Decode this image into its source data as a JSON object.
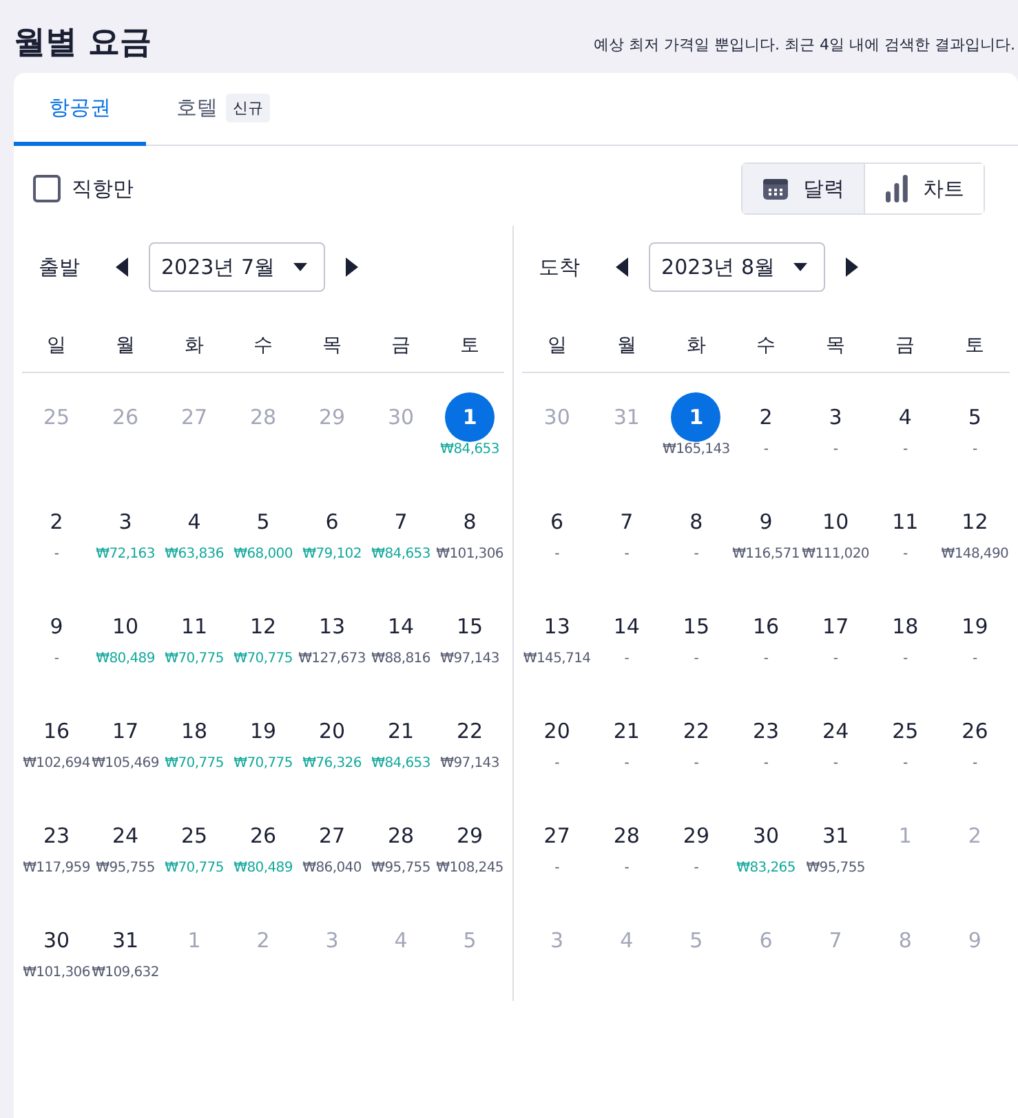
{
  "title": "월별 요금",
  "notice": "예상 최저 가격일 뿐입니다. 최근 4일 내에 검색한 결과입니다.",
  "tabs": [
    {
      "label": "항공권",
      "selected": true
    },
    {
      "label": "호텔",
      "badge": "신규",
      "selected": false
    }
  ],
  "direct_only": {
    "label": "직항만",
    "checked": false
  },
  "view_toggle": [
    {
      "label": "달력",
      "kind": "calendar",
      "selected": true
    },
    {
      "label": "차트",
      "kind": "chart",
      "selected": false
    }
  ],
  "calendars": [
    {
      "label": "출발",
      "month": "2023년 7월",
      "weekdays": [
        "일",
        "월",
        "화",
        "수",
        "목",
        "금",
        "토"
      ],
      "weeks": [
        [
          {
            "d": "25",
            "muted": true,
            "selected": false
          },
          {
            "d": "26",
            "muted": true,
            "selected": false
          },
          {
            "d": "27",
            "muted": true,
            "selected": false
          },
          {
            "d": "28",
            "muted": true,
            "selected": false
          },
          {
            "d": "29",
            "muted": true,
            "selected": false
          },
          {
            "d": "30",
            "muted": true,
            "selected": false
          },
          {
            "d": "1",
            "muted": false,
            "selected": true,
            "price": "₩84,653",
            "cheap": true
          }
        ],
        [
          {
            "d": "2",
            "muted": false,
            "selected": false,
            "price": "-",
            "cheap": false
          },
          {
            "d": "3",
            "muted": false,
            "selected": false,
            "price": "₩72,163",
            "cheap": true
          },
          {
            "d": "4",
            "muted": false,
            "selected": false,
            "price": "₩63,836",
            "cheap": true
          },
          {
            "d": "5",
            "muted": false,
            "selected": false,
            "price": "₩68,000",
            "cheap": true
          },
          {
            "d": "6",
            "muted": false,
            "selected": false,
            "price": "₩79,102",
            "cheap": true
          },
          {
            "d": "7",
            "muted": false,
            "selected": false,
            "price": "₩84,653",
            "cheap": true
          },
          {
            "d": "8",
            "muted": false,
            "selected": false,
            "price": "₩101,306",
            "cheap": false
          }
        ],
        [
          {
            "d": "9",
            "muted": false,
            "selected": false,
            "price": "-",
            "cheap": false
          },
          {
            "d": "10",
            "muted": false,
            "selected": false,
            "price": "₩80,489",
            "cheap": true
          },
          {
            "d": "11",
            "muted": false,
            "selected": false,
            "price": "₩70,775",
            "cheap": true
          },
          {
            "d": "12",
            "muted": false,
            "selected": false,
            "price": "₩70,775",
            "cheap": true
          },
          {
            "d": "13",
            "muted": false,
            "selected": false,
            "price": "₩127,673",
            "cheap": false
          },
          {
            "d": "14",
            "muted": false,
            "selected": false,
            "price": "₩88,816",
            "cheap": false
          },
          {
            "d": "15",
            "muted": false,
            "selected": false,
            "price": "₩97,143",
            "cheap": false
          }
        ],
        [
          {
            "d": "16",
            "muted": false,
            "selected": false,
            "price": "₩102,694",
            "cheap": false
          },
          {
            "d": "17",
            "muted": false,
            "selected": false,
            "price": "₩105,469",
            "cheap": false
          },
          {
            "d": "18",
            "muted": false,
            "selected": false,
            "price": "₩70,775",
            "cheap": true
          },
          {
            "d": "19",
            "muted": false,
            "selected": false,
            "price": "₩70,775",
            "cheap": true
          },
          {
            "d": "20",
            "muted": false,
            "selected": false,
            "price": "₩76,326",
            "cheap": true
          },
          {
            "d": "21",
            "muted": false,
            "selected": false,
            "price": "₩84,653",
            "cheap": true
          },
          {
            "d": "22",
            "muted": false,
            "selected": false,
            "price": "₩97,143",
            "cheap": false
          }
        ],
        [
          {
            "d": "23",
            "muted": false,
            "selected": false,
            "price": "₩117,959",
            "cheap": false
          },
          {
            "d": "24",
            "muted": false,
            "selected": false,
            "price": "₩95,755",
            "cheap": false
          },
          {
            "d": "25",
            "muted": false,
            "selected": false,
            "price": "₩70,775",
            "cheap": true
          },
          {
            "d": "26",
            "muted": false,
            "selected": false,
            "price": "₩80,489",
            "cheap": true
          },
          {
            "d": "27",
            "muted": false,
            "selected": false,
            "price": "₩86,040",
            "cheap": false
          },
          {
            "d": "28",
            "muted": false,
            "selected": false,
            "price": "₩95,755",
            "cheap": false
          },
          {
            "d": "29",
            "muted": false,
            "selected": false,
            "price": "₩108,245",
            "cheap": false
          }
        ],
        [
          {
            "d": "30",
            "muted": false,
            "selected": false,
            "price": "₩101,306",
            "cheap": false
          },
          {
            "d": "31",
            "muted": false,
            "selected": false,
            "price": "₩109,632",
            "cheap": false
          },
          {
            "d": "1",
            "muted": true,
            "selected": false
          },
          {
            "d": "2",
            "muted": true,
            "selected": false
          },
          {
            "d": "3",
            "muted": true,
            "selected": false
          },
          {
            "d": "4",
            "muted": true,
            "selected": false
          },
          {
            "d": "5",
            "muted": true,
            "selected": false
          }
        ]
      ]
    },
    {
      "label": "도착",
      "month": "2023년 8월",
      "weekdays": [
        "일",
        "월",
        "화",
        "수",
        "목",
        "금",
        "토"
      ],
      "weeks": [
        [
          {
            "d": "30",
            "muted": true,
            "selected": false
          },
          {
            "d": "31",
            "muted": true,
            "selected": false
          },
          {
            "d": "1",
            "muted": false,
            "selected": true,
            "price": "₩165,143",
            "cheap": false
          },
          {
            "d": "2",
            "muted": false,
            "selected": false,
            "price": "-",
            "cheap": false
          },
          {
            "d": "3",
            "muted": false,
            "selected": false,
            "price": "-",
            "cheap": false
          },
          {
            "d": "4",
            "muted": false,
            "selected": false,
            "price": "-",
            "cheap": false
          },
          {
            "d": "5",
            "muted": false,
            "selected": false,
            "price": "-",
            "cheap": false
          }
        ],
        [
          {
            "d": "6",
            "muted": false,
            "selected": false,
            "price": "-",
            "cheap": false
          },
          {
            "d": "7",
            "muted": false,
            "selected": false,
            "price": "-",
            "cheap": false
          },
          {
            "d": "8",
            "muted": false,
            "selected": false,
            "price": "-",
            "cheap": false
          },
          {
            "d": "9",
            "muted": false,
            "selected": false,
            "price": "₩116,571",
            "cheap": false
          },
          {
            "d": "10",
            "muted": false,
            "selected": false,
            "price": "₩111,020",
            "cheap": false
          },
          {
            "d": "11",
            "muted": false,
            "selected": false,
            "price": "-",
            "cheap": false
          },
          {
            "d": "12",
            "muted": false,
            "selected": false,
            "price": "₩148,490",
            "cheap": false
          }
        ],
        [
          {
            "d": "13",
            "muted": false,
            "selected": false,
            "price": "₩145,714",
            "cheap": false
          },
          {
            "d": "14",
            "muted": false,
            "selected": false,
            "price": "-",
            "cheap": false
          },
          {
            "d": "15",
            "muted": false,
            "selected": false,
            "price": "-",
            "cheap": false
          },
          {
            "d": "16",
            "muted": false,
            "selected": false,
            "price": "-",
            "cheap": false
          },
          {
            "d": "17",
            "muted": false,
            "selected": false,
            "price": "-",
            "cheap": false
          },
          {
            "d": "18",
            "muted": false,
            "selected": false,
            "price": "-",
            "cheap": false
          },
          {
            "d": "19",
            "muted": false,
            "selected": false,
            "price": "-",
            "cheap": false
          }
        ],
        [
          {
            "d": "20",
            "muted": false,
            "selected": false,
            "price": "-",
            "cheap": false
          },
          {
            "d": "21",
            "muted": false,
            "selected": false,
            "price": "-",
            "cheap": false
          },
          {
            "d": "22",
            "muted": false,
            "selected": false,
            "price": "-",
            "cheap": false
          },
          {
            "d": "23",
            "muted": false,
            "selected": false,
            "price": "-",
            "cheap": false
          },
          {
            "d": "24",
            "muted": false,
            "selected": false,
            "price": "-",
            "cheap": false
          },
          {
            "d": "25",
            "muted": false,
            "selected": false,
            "price": "-",
            "cheap": false
          },
          {
            "d": "26",
            "muted": false,
            "selected": false,
            "price": "-",
            "cheap": false
          }
        ],
        [
          {
            "d": "27",
            "muted": false,
            "selected": false,
            "price": "-",
            "cheap": false
          },
          {
            "d": "28",
            "muted": false,
            "selected": false,
            "price": "-",
            "cheap": false
          },
          {
            "d": "29",
            "muted": false,
            "selected": false,
            "price": "-",
            "cheap": false
          },
          {
            "d": "30",
            "muted": false,
            "selected": false,
            "price": "₩83,265",
            "cheap": true
          },
          {
            "d": "31",
            "muted": false,
            "selected": false,
            "price": "₩95,755",
            "cheap": false
          },
          {
            "d": "1",
            "muted": true,
            "selected": false
          },
          {
            "d": "2",
            "muted": true,
            "selected": false
          }
        ],
        [
          {
            "d": "3",
            "muted": true,
            "selected": false
          },
          {
            "d": "4",
            "muted": true,
            "selected": false
          },
          {
            "d": "5",
            "muted": true,
            "selected": false
          },
          {
            "d": "6",
            "muted": true,
            "selected": false
          },
          {
            "d": "7",
            "muted": true,
            "selected": false
          },
          {
            "d": "8",
            "muted": true,
            "selected": false
          },
          {
            "d": "9",
            "muted": true,
            "selected": false
          }
        ]
      ]
    }
  ]
}
